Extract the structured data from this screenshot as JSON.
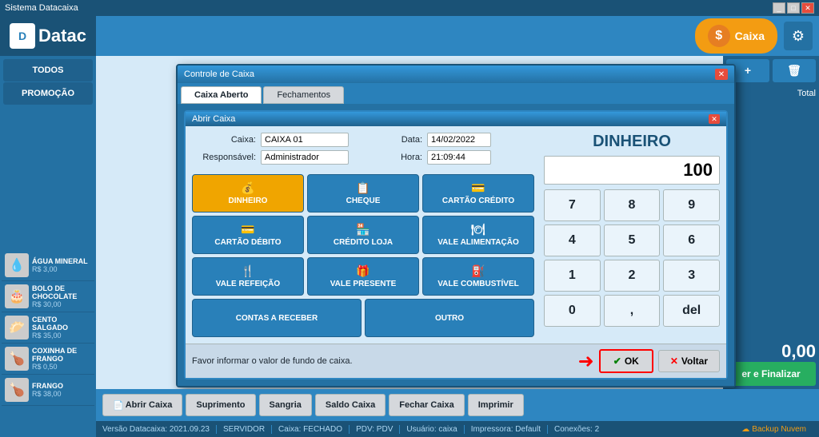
{
  "app": {
    "title": "Sistema Datacaixa",
    "logo": "Datac",
    "logo_icon": "D"
  },
  "window": {
    "title": "Controle de Caixa",
    "close_btn": "✕",
    "tabs": [
      {
        "label": "Caixa Aberto",
        "active": true
      },
      {
        "label": "Fechamentos",
        "active": false
      }
    ]
  },
  "modal": {
    "title": "Abrir Caixa",
    "close_btn": "✕",
    "fields": {
      "caixa_label": "Caixa:",
      "caixa_value": "CAIXA 01",
      "data_label": "Data:",
      "data_value": "14/02/2022",
      "responsavel_label": "Responsável:",
      "responsavel_value": "Administrador",
      "hora_label": "Hora:",
      "hora_value": "21:09:44"
    },
    "payment_methods": [
      {
        "id": "dinheiro",
        "label": "DINHEIRO",
        "icon": "💰",
        "cols": 1
      },
      {
        "id": "cheque",
        "label": "CHEQUE",
        "icon": "📋",
        "cols": 1
      },
      {
        "id": "cartao_credito",
        "label": "CARTÃO\nCRÉDITO",
        "icon": "💳",
        "cols": 1
      },
      {
        "id": "cartao_debito",
        "label": "CARTÃO\nDÉBITO",
        "icon": "💳",
        "cols": 1
      },
      {
        "id": "credito_loja",
        "label": "CRÉDITO LOJA",
        "icon": "🏪",
        "cols": 1
      },
      {
        "id": "vale_alimentacao",
        "label": "VALE\nALIMENTAÇÃO",
        "icon": "🍽",
        "cols": 1
      },
      {
        "id": "vale_refeicao",
        "label": "VALE\nREFEIÇÃO",
        "icon": "🍴",
        "cols": 1
      },
      {
        "id": "vale_presente",
        "label": "VALE\nPRESENTE",
        "icon": "🎁",
        "cols": 1
      },
      {
        "id": "vale_combustivel",
        "label": "VALE\nCOMBUSTÍVEL",
        "icon": "⛽",
        "cols": 1
      },
      {
        "id": "contas_receber",
        "label": "CONTAS A\nRECEBER",
        "icon": "",
        "cols": 1
      },
      {
        "id": "outro",
        "label": "OUTRO",
        "icon": "",
        "cols": 1
      }
    ],
    "active_payment": "DINHEIRO",
    "display_value": "100",
    "numpad": {
      "keys": [
        "7",
        "8",
        "9",
        "4",
        "5",
        "6",
        "1",
        "2",
        "3",
        "0",
        ",",
        "del"
      ]
    },
    "hint": "Favor informar o valor de fundo de caixa.",
    "ok_btn": "✔ OK",
    "voltar_btn": "✕ Voltar"
  },
  "sidebar": {
    "items": [
      {
        "label": "TODOS"
      },
      {
        "label": "PROMOÇÃO"
      }
    ],
    "products": [
      {
        "name": "ÁGUA MINERAL",
        "price": "R$ 3,00",
        "emoji": "💧"
      },
      {
        "name": "BOLO DE CHOCOLATE",
        "price": "R$ 30,00",
        "emoji": "🎂"
      },
      {
        "name": "CENTO SALGADO",
        "price": "R$ 35,00",
        "emoji": "🥟"
      },
      {
        "name": "COXINHA DE FRANGO",
        "price": "R$ 0,50",
        "emoji": "🍗"
      },
      {
        "name": "FRANGO",
        "price": "R$ 38,00",
        "emoji": "🍗"
      }
    ]
  },
  "right_panel": {
    "add_btn": "+",
    "del_btn": "🗑",
    "total_label": "Total",
    "total_value": "0,00",
    "confirm_btn": "er e Finalizar"
  },
  "top_bar": {
    "caixa_btn": "Caixa",
    "settings_icon": "⚙"
  },
  "bottom_bar": {
    "buttons": [
      {
        "label": "Abrir Caixa",
        "underline": "A",
        "icon": "📄"
      },
      {
        "label": "Suprimento"
      },
      {
        "label": "Sangria"
      },
      {
        "label": "Saldo Caixa"
      },
      {
        "label": "Fechar Caixa"
      },
      {
        "label": "Imprimir"
      }
    ]
  },
  "status_bar": {
    "version": "Versão Datacaixa: 2021.09.23",
    "server": "SERVIDOR",
    "caixa": "Caixa: FECHADO",
    "pdv": "PDV: PDV",
    "usuario": "Usuário: caixa",
    "impressora": "Impressora: Default",
    "conexoes": "Conexões: 2"
  }
}
